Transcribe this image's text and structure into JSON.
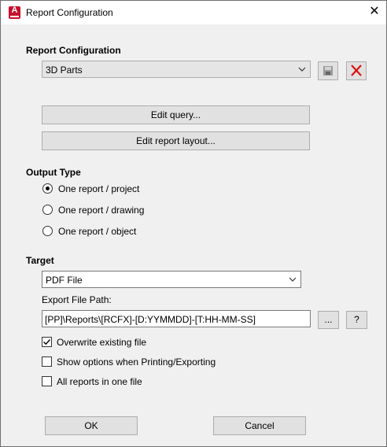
{
  "window": {
    "title": "Report Configuration",
    "close_glyph": "✕",
    "app_icon_letter": "A"
  },
  "report_configuration": {
    "heading": "Report Configuration",
    "selected": "3D Parts",
    "save_icon": "save-icon",
    "delete_icon": "delete-icon",
    "edit_query_label": "Edit query...",
    "edit_layout_label": "Edit report layout..."
  },
  "output_type": {
    "heading": "Output Type",
    "options": [
      {
        "label": "One report / project",
        "checked": true
      },
      {
        "label": "One report / drawing",
        "checked": false
      },
      {
        "label": "One report / object",
        "checked": false
      }
    ]
  },
  "target": {
    "heading": "Target",
    "selected": "PDF File",
    "export_path_label": "Export File Path:",
    "export_path_value": "[PP]\\Reports\\[RCFX]-[D:YYMMDD]-[T:HH-MM-SS]",
    "browse_label": "...",
    "help_label": "?"
  },
  "options": {
    "items": [
      {
        "label": "Overwrite existing file",
        "checked": true
      },
      {
        "label": "Show options when Printing/Exporting",
        "checked": false
      },
      {
        "label": "All reports in one file",
        "checked": false
      }
    ]
  },
  "footer": {
    "ok_label": "OK",
    "cancel_label": "Cancel"
  }
}
